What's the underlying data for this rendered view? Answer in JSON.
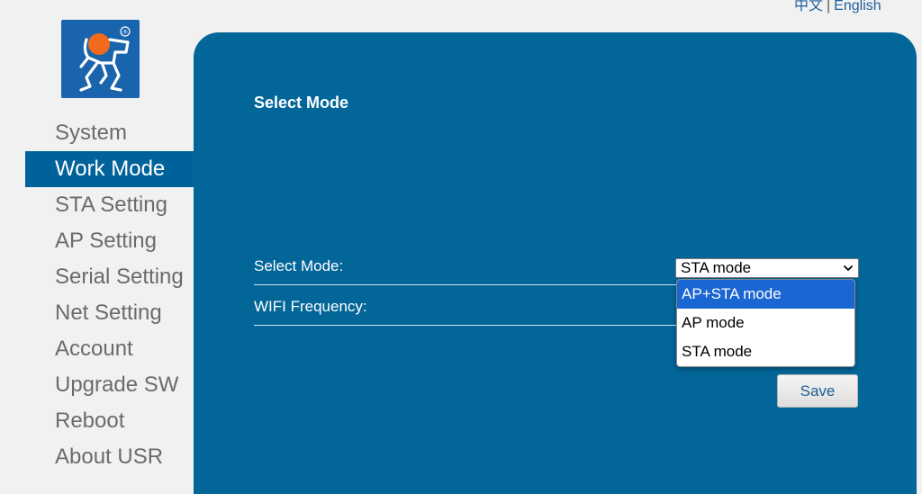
{
  "header": {
    "lang_chinese": "中文",
    "lang_separator": "|",
    "lang_english": "English"
  },
  "logo": {
    "icon": "usr-running-man-logo",
    "registered_mark": "®",
    "bg_color": "#1a63ad",
    "head_color": "#f26b1d"
  },
  "sidebar": {
    "items": [
      {
        "label": "System",
        "active": false
      },
      {
        "label": "Work Mode",
        "active": true
      },
      {
        "label": "STA Setting",
        "active": false
      },
      {
        "label": "AP Setting",
        "active": false
      },
      {
        "label": "Serial Setting",
        "active": false
      },
      {
        "label": "Net Setting",
        "active": false
      },
      {
        "label": "Account",
        "active": false
      },
      {
        "label": "Upgrade SW",
        "active": false
      },
      {
        "label": "Reboot",
        "active": false
      },
      {
        "label": "About USR",
        "active": false
      }
    ]
  },
  "main": {
    "title": "Select Mode",
    "select_mode_label": "Select Mode:",
    "select_mode_value": "STA mode",
    "wifi_frequency_label": "WIFI Frequency:",
    "dropdown_options": [
      {
        "label": "AP+STA mode",
        "highlighted": true
      },
      {
        "label": "AP mode",
        "highlighted": false
      },
      {
        "label": "STA mode",
        "highlighted": false
      }
    ],
    "save_label": "Save"
  },
  "colors": {
    "panel_bg": "#036699",
    "active_nav_bg": "#00629a",
    "dropdown_highlight": "#1a66d2"
  }
}
